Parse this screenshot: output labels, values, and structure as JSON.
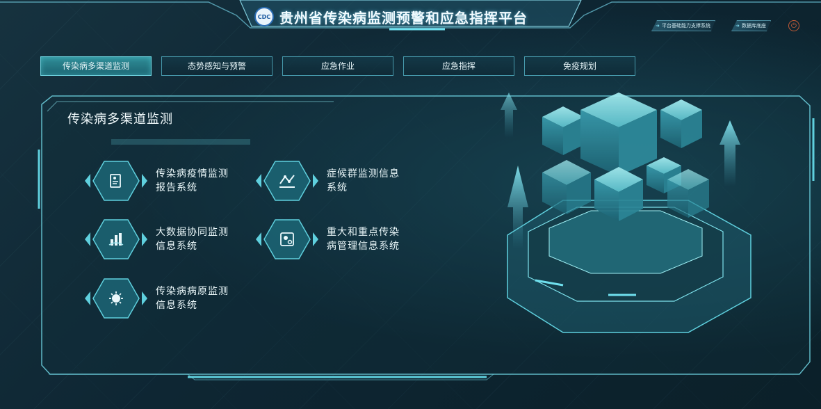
{
  "header": {
    "title": "贵州省传染病监测预警和应急指挥平台",
    "logo_text": "CDC",
    "right_links": [
      "平台基础能力支撑系统",
      "数据库底座"
    ],
    "power_icon": "power-icon"
  },
  "tabs": [
    {
      "label": "传染病多渠道监测",
      "active": true
    },
    {
      "label": "态势感知与预警",
      "active": false
    },
    {
      "label": "应急作业",
      "active": false
    },
    {
      "label": "应急指挥",
      "active": false
    },
    {
      "label": "免疫规划",
      "active": false
    }
  ],
  "panel": {
    "title": "传染病多渠道监测",
    "systems": [
      {
        "label": "传染病疫情监测报告系统",
        "icon": "report-document-icon"
      },
      {
        "label": "症候群监测信息系统",
        "icon": "line-graph-icon"
      },
      {
        "label": "大数据协同监测信息系统",
        "icon": "bar-chart-icon"
      },
      {
        "label": "重大和重点传染病管理信息系统",
        "icon": "virus-gear-icon"
      },
      {
        "label": "传染病病原监测信息系统",
        "icon": "virus-icon"
      }
    ]
  },
  "colors": {
    "accent": "#5fd0de",
    "tab_active": "#2f8e98",
    "background": "#0c2430",
    "power": "#e0663a"
  }
}
